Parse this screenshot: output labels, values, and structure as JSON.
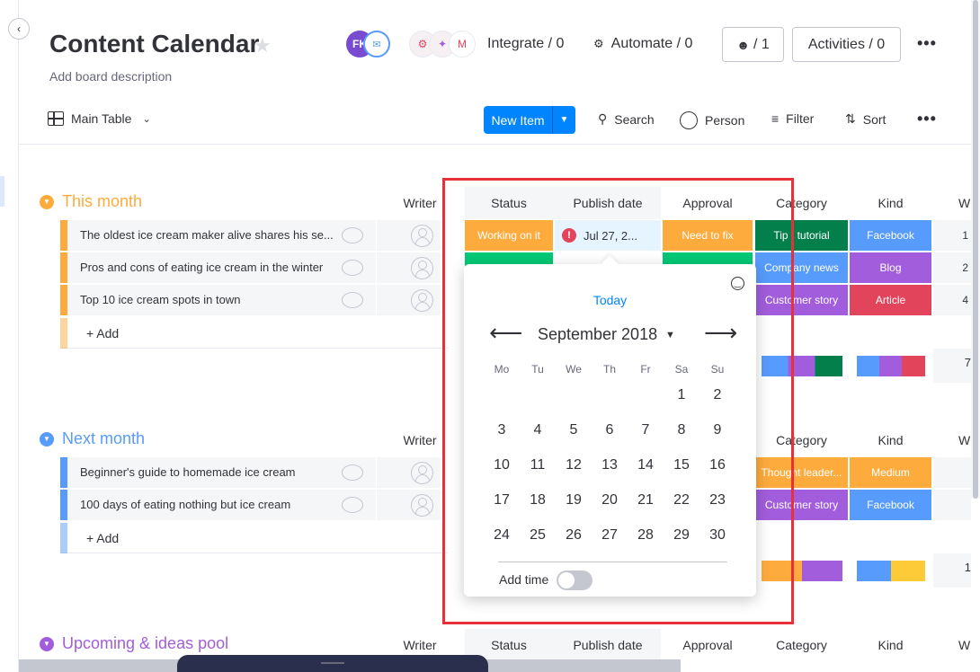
{
  "header": {
    "title": "Content Calendar",
    "description": "Add board description",
    "avatar_initials": "FK",
    "integrate_label": "Integrate / 0",
    "automate_label": "Automate / 0",
    "members_label": "/ 1",
    "activities_label": "Activities / 0"
  },
  "toolbar": {
    "view_label": "Main Table",
    "new_item_label": "New Item",
    "search_label": "Search",
    "person_label": "Person",
    "filter_label": "Filter",
    "sort_label": "Sort"
  },
  "columns": {
    "writer": "Writer",
    "status": "Status",
    "publish_date": "Publish date",
    "approval": "Approval",
    "category": "Category",
    "kind": "Kind",
    "extra": "W"
  },
  "groups": [
    {
      "name": "This month",
      "color": "#fdab3d",
      "add_label": "+ Add",
      "items": [
        {
          "name": "The oldest ice cream maker alive shares his se...",
          "status": "Working on it",
          "date": "Jul 27, 2...",
          "approval": "Need to fix",
          "category": "Tip / tutorial",
          "kind": "Facebook",
          "extra": "1"
        },
        {
          "name": "Pros and cons of eating ice cream in the winter",
          "category": "Company news",
          "kind": "Blog",
          "extra": "2"
        },
        {
          "name": "Top 10 ice cream spots in town",
          "category": "Customer story",
          "kind": "Article",
          "extra": "4"
        }
      ],
      "summary_extra": "7"
    },
    {
      "name": "Next month",
      "color": "#579bfc",
      "add_label": "+ Add",
      "items": [
        {
          "name": "Beginner's guide to homemade ice cream",
          "category": "Thought leader...",
          "kind": "Medium"
        },
        {
          "name": "100 days of eating nothing but ice cream",
          "category": "Customer story",
          "kind": "Facebook"
        }
      ],
      "summary_extra": "1"
    },
    {
      "name": "Upcoming & ideas pool",
      "color": "#a25ddc"
    }
  ],
  "datepicker": {
    "today_label": "Today",
    "month_label": "September 2018",
    "weekdays": [
      "Mo",
      "Tu",
      "We",
      "Th",
      "Fr",
      "Sa",
      "Su"
    ],
    "weeks": [
      [
        "",
        "",
        "",
        "",
        "",
        "1",
        "2"
      ],
      [
        "3",
        "4",
        "5",
        "6",
        "7",
        "8",
        "9"
      ],
      [
        "10",
        "11",
        "12",
        "13",
        "14",
        "15",
        "16"
      ],
      [
        "17",
        "18",
        "19",
        "20",
        "21",
        "22",
        "23"
      ],
      [
        "24",
        "25",
        "26",
        "27",
        "28",
        "29",
        "30"
      ]
    ],
    "add_time_label": "Add time"
  },
  "colors": {
    "primary": "#0085ff",
    "working_on_it": "#fdab3d",
    "done": "#00c875",
    "need_to_fix": "#fdab3d",
    "tip_tutorial": "#037f4c",
    "company_news": "#579bfc",
    "customer_story": "#a25ddc",
    "thought_leadership": "#fdab3d",
    "facebook": "#579bfc",
    "blog": "#a25ddc",
    "article": "#e2445c",
    "medium": "#fdab3d",
    "highlight": "#e8303a"
  }
}
